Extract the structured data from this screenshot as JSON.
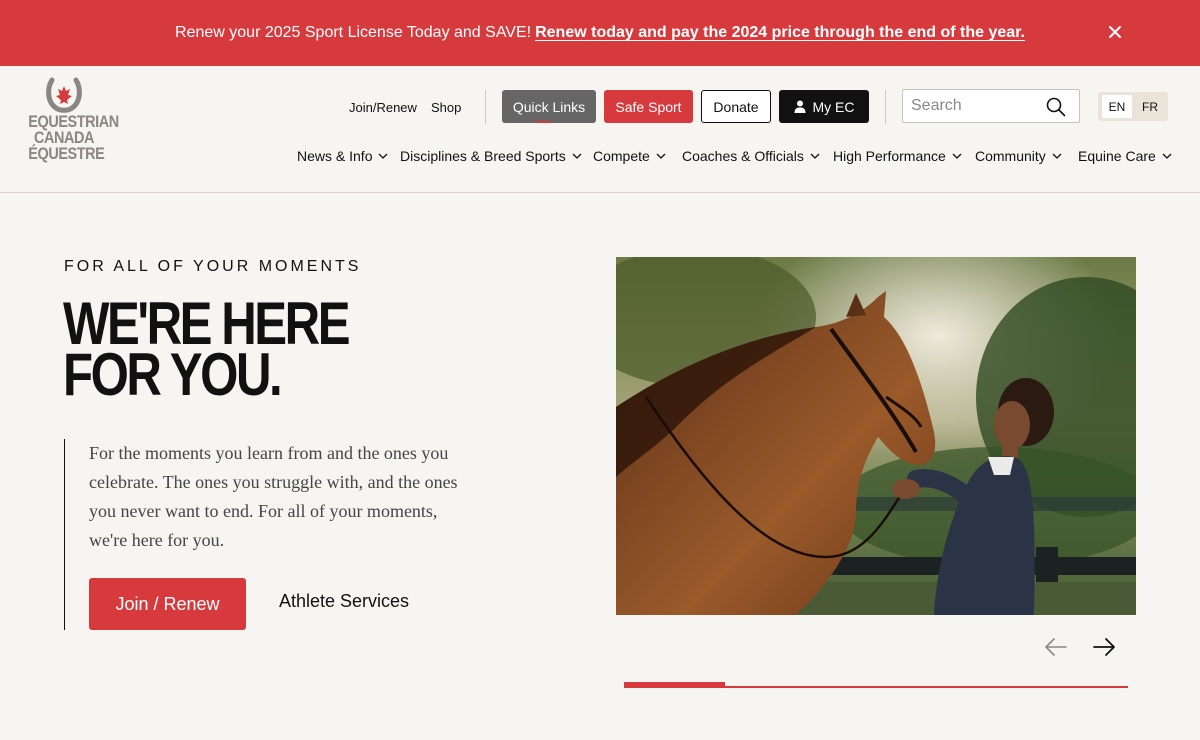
{
  "banner": {
    "message": "Renew your 2025 Sport License Today and SAVE!",
    "link": "Renew today and pay the 2024 price through the end of the year.",
    "close_icon": "close-icon"
  },
  "logo": {
    "line1": "EQUESTRIAN",
    "line2": "CANADA",
    "line3": "ÉQUESTRE",
    "icon": "horseshoe-maple-leaf-icon"
  },
  "utility": {
    "join_renew": "Join/Renew",
    "shop": "Shop",
    "quick_links": "Quick Links",
    "safe_sport": "Safe Sport",
    "donate": "Donate",
    "my_ec": "My EC"
  },
  "search": {
    "placeholder": "Search",
    "icon": "search-icon"
  },
  "lang": {
    "en": "EN",
    "fr": "FR"
  },
  "nav": [
    {
      "label": "News & Info"
    },
    {
      "label": "Disciplines & Breed Sports"
    },
    {
      "label": "Compete"
    },
    {
      "label": "Coaches & Officials"
    },
    {
      "label": "High Performance"
    },
    {
      "label": "Community"
    },
    {
      "label": "Equine Care"
    }
  ],
  "hero": {
    "eyebrow": "FOR ALL OF YOUR MOMENTS",
    "headline_1": "WE'RE HERE",
    "headline_2": "FOR YOU.",
    "body": "For the moments you learn from and the ones you celebrate. The ones you struggle with, and the ones you never want to end. For all of your moments, we're here for you.",
    "cta_primary": "Join / Renew",
    "cta_secondary": "Athlete Services"
  },
  "carousel": {
    "progress": 0.2,
    "prev_icon": "arrow-left-icon",
    "next_icon": "arrow-right-icon"
  },
  "colors": {
    "brand_red": "#d63a3d",
    "background": "#f7f5f1",
    "dark": "#111111"
  }
}
